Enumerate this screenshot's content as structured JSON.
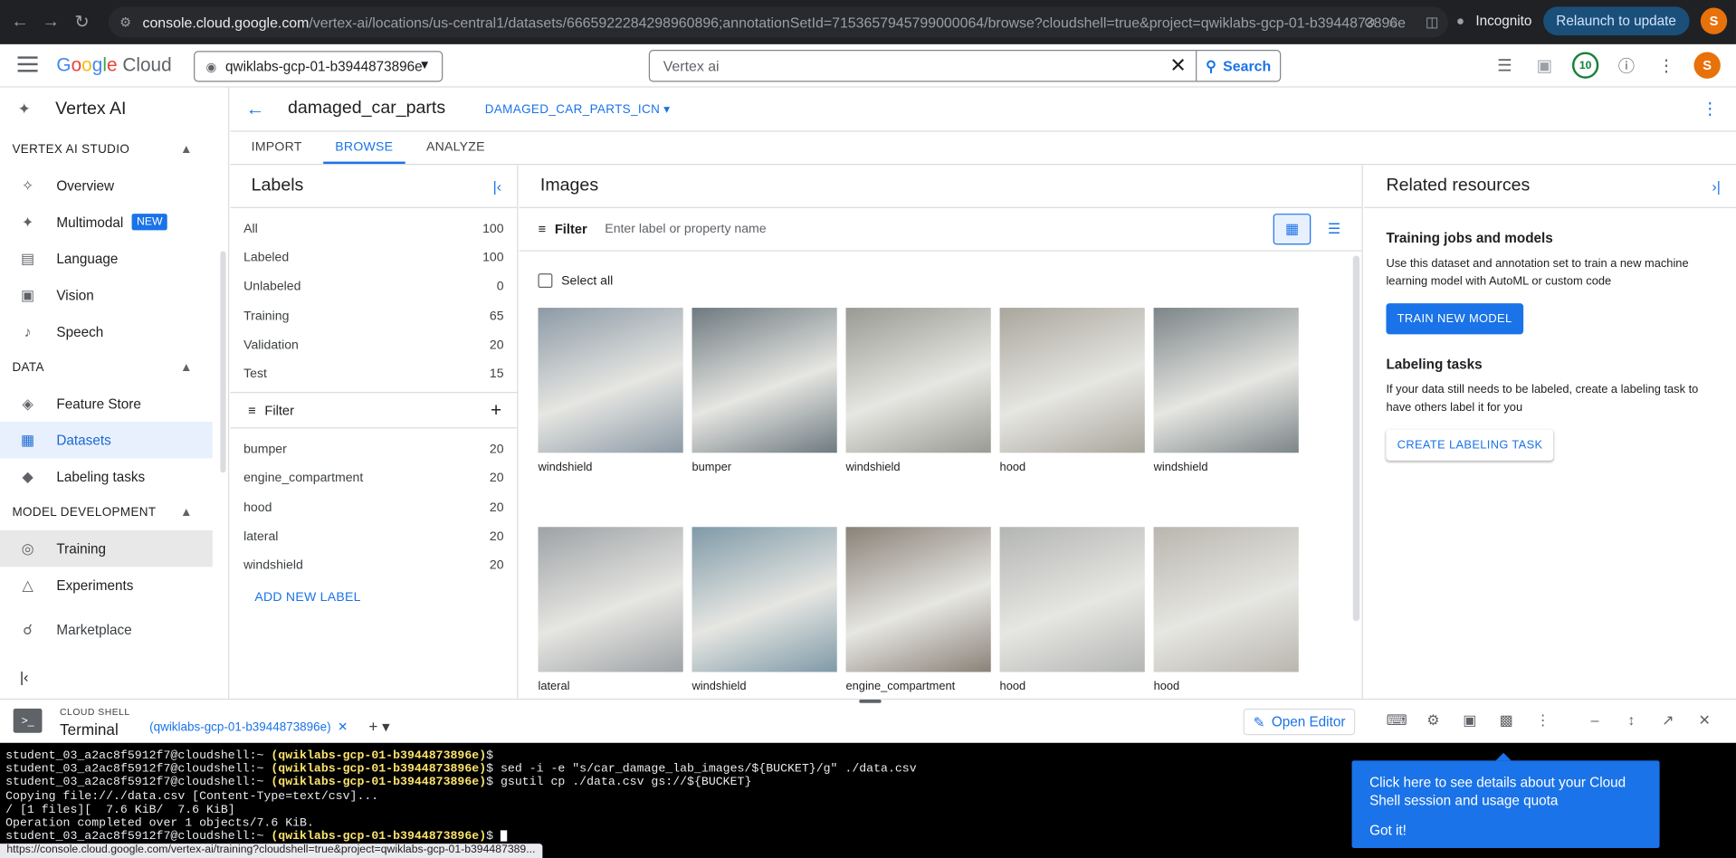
{
  "browser": {
    "url_host": "console.cloud.google.com",
    "url_path": "/vertex-ai/locations/us-central1/datasets/6665922284298960896;annotationSetId=7153657945799000064/browse?cloudshell=true&project=qwiklabs-gcp-01-b3944873896e",
    "incognito_label": "Incognito",
    "relaunch_label": "Relaunch to update",
    "avatar_letter": "S",
    "status_url": "https://console.cloud.google.com/vertex-ai/training?cloudshell=true&project=qwiklabs-gcp-01-b394487389..."
  },
  "header": {
    "logo_google": "Google",
    "logo_cloud": "Cloud",
    "project": "qwiklabs-gcp-01-b3944873896e",
    "search_value": "Vertex ai",
    "search_button": "Search",
    "notifications_count": "10"
  },
  "sidebar": {
    "title": "Vertex AI",
    "sections": [
      {
        "label": "VERTEX AI STUDIO",
        "items": [
          {
            "label": "Overview",
            "icon": "sparkle-icon"
          },
          {
            "label": "Multimodal",
            "icon": "sparkle-icon",
            "badge": "NEW"
          },
          {
            "label": "Language",
            "icon": "document-icon"
          },
          {
            "label": "Vision",
            "icon": "image-icon"
          },
          {
            "label": "Speech",
            "icon": "speaker-icon"
          }
        ]
      },
      {
        "label": "DATA",
        "items": [
          {
            "label": "Feature Store",
            "icon": "stack-icon"
          },
          {
            "label": "Datasets",
            "icon": "grid-icon"
          },
          {
            "label": "Labeling tasks",
            "icon": "tag-icon"
          }
        ]
      },
      {
        "label": "MODEL DEVELOPMENT",
        "items": [
          {
            "label": "Training",
            "icon": "training-icon"
          },
          {
            "label": "Experiments",
            "icon": "flask-icon"
          }
        ]
      }
    ],
    "marketplace": "Marketplace"
  },
  "dataset": {
    "name": "damaged_car_parts",
    "annotation_set": "DAMAGED_CAR_PARTS_ICN",
    "tabs": [
      "IMPORT",
      "BROWSE",
      "ANALYZE"
    ],
    "active_tab": "BROWSE"
  },
  "labels_pane": {
    "title": "Labels",
    "counts": [
      {
        "label": "All",
        "value": "100"
      },
      {
        "label": "Labeled",
        "value": "100"
      },
      {
        "label": "Unlabeled",
        "value": "0"
      },
      {
        "label": "Training",
        "value": "65"
      },
      {
        "label": "Validation",
        "value": "20"
      },
      {
        "label": "Test",
        "value": "15"
      }
    ],
    "filter_label": "Filter",
    "labels": [
      {
        "label": "bumper",
        "value": "20"
      },
      {
        "label": "engine_compartment",
        "value": "20"
      },
      {
        "label": "hood",
        "value": "20"
      },
      {
        "label": "lateral",
        "value": "20"
      },
      {
        "label": "windshield",
        "value": "20"
      }
    ],
    "add_label": "ADD NEW LABEL"
  },
  "images_pane": {
    "title": "Images",
    "filter_label": "Filter",
    "filter_placeholder": "Enter label or property name",
    "select_all": "Select all",
    "images": [
      {
        "caption": "windshield",
        "color": "#8c9aa6"
      },
      {
        "caption": "bumper",
        "color": "#6e7a80"
      },
      {
        "caption": "windshield",
        "color": "#9a9a94"
      },
      {
        "caption": "hood",
        "color": "#a9a69c"
      },
      {
        "caption": "windshield",
        "color": "#7c8588"
      },
      {
        "caption": "lateral",
        "color": "#9ea2a6"
      },
      {
        "caption": "windshield",
        "color": "#7f9aa8"
      },
      {
        "caption": "engine_compartment",
        "color": "#8a8278"
      },
      {
        "caption": "hood",
        "color": "#b4b6b4"
      },
      {
        "caption": "hood",
        "color": "#b9b6ae"
      }
    ]
  },
  "related": {
    "title": "Related resources",
    "training_title": "Training jobs and models",
    "training_text": "Use this dataset and annotation set to train a new machine learning model with AutoML or custom code",
    "train_button": "TRAIN NEW MODEL",
    "labeling_title": "Labeling tasks",
    "labeling_text": "If your data still needs to be labeled, create a labeling task to have others label it for you",
    "labeling_button": "CREATE LABELING TASK"
  },
  "shell": {
    "kicker": "CLOUD SHELL",
    "title": "Terminal",
    "tab_label": "(qwiklabs-gcp-01-b3944873896e)",
    "open_editor": "Open Editor",
    "lines": [
      {
        "prompt": "student_03_a2ac8f5912f7@cloudshell:~ ",
        "project": "(qwiklabs-gcp-01-b3944873896e)",
        "cmd": "$"
      },
      {
        "prompt": "student_03_a2ac8f5912f7@cloudshell:~ ",
        "project": "(qwiklabs-gcp-01-b3944873896e)",
        "cmd": "$ sed -i -e \"s/car_damage_lab_images/${BUCKET}/g\" ./data.csv"
      },
      {
        "prompt": "student_03_a2ac8f5912f7@cloudshell:~ ",
        "project": "(qwiklabs-gcp-01-b3944873896e)",
        "cmd": "$ gsutil cp ./data.csv gs://${BUCKET}"
      },
      {
        "prompt": "Copying file://./data.csv [Content-Type=text/csv]...",
        "project": "",
        "cmd": ""
      },
      {
        "prompt": "/ [1 files][  7.6 KiB/  7.6 KiB]",
        "project": "",
        "cmd": ""
      },
      {
        "prompt": "Operation completed over 1 objects/7.6 KiB.",
        "project": "",
        "cmd": ""
      },
      {
        "prompt": "student_03_a2ac8f5912f7@cloudshell:~ ",
        "project": "(qwiklabs-gcp-01-b3944873896e)",
        "cmd": "$ "
      }
    ],
    "tooltip_text": "Click here to see details about your Cloud Shell session and usage quota",
    "tooltip_button": "Got it!"
  }
}
